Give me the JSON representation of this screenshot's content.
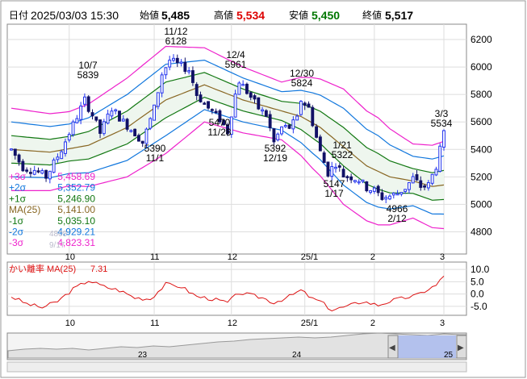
{
  "header": {
    "date_label": "日付",
    "datetime": "2025/03/03 15:30",
    "open_label": "始値",
    "open_value": "5,485",
    "high_label": "高値",
    "high_value": "5,534",
    "low_label": "安値",
    "low_value": "5,450",
    "close_label": "終値",
    "close_value": "5,517"
  },
  "colors": {
    "up_candle": "#2233ee",
    "down_candle": "#111166",
    "band3": "#ee22cc",
    "band2": "#1177dd",
    "band1": "#117711",
    "ma": "#886622",
    "band_fill": "#eef6ee",
    "deviation": "#dd1111",
    "high_value": "#dd0000",
    "low_value": "#007700",
    "navigator_fill": "#aabbee"
  },
  "legend": [
    {
      "label": "+3σ",
      "value": "5,458.69",
      "color": "#ee22cc"
    },
    {
      "label": "+2σ",
      "value": "5,352.79",
      "color": "#1177dd"
    },
    {
      "label": "+1σ",
      "value": "5,246.90",
      "color": "#117711"
    },
    {
      "label": "MA(25)",
      "value": "5,141.00",
      "color": "#886622"
    },
    {
      "label": "-1σ",
      "value": "5,035.10",
      "color": "#117711"
    },
    {
      "label": "-2σ",
      "value": "4,929.21",
      "color": "#1177dd"
    },
    {
      "label": "-3σ",
      "value": "4,823.31",
      "color": "#ee22cc"
    }
  ],
  "ghost_texts": [
    "4808",
    "9/17"
  ],
  "annotations": [
    {
      "line1": "10/7",
      "line2": "5839",
      "anchor": "above"
    },
    {
      "line1": "11/12",
      "line2": "6128",
      "anchor": "above"
    },
    {
      "line1": "12/4",
      "line2": "5961",
      "anchor": "above"
    },
    {
      "line1": "12/30",
      "line2": "5824",
      "anchor": "above"
    },
    {
      "line1": "3/3",
      "line2": "5534",
      "anchor": "above"
    },
    {
      "line1": "5390",
      "line2": "11/1",
      "anchor": "below"
    },
    {
      "line1": "5470",
      "line2": "11/28",
      "anchor": "below"
    },
    {
      "line1": "5392",
      "line2": "12/19",
      "anchor": "below"
    },
    {
      "line1": "1/21",
      "line2": "5322",
      "anchor": "below"
    },
    {
      "line1": "5147",
      "line2": "1/17",
      "anchor": "below"
    },
    {
      "line1": "4966",
      "line2": "2/12",
      "anchor": "below"
    }
  ],
  "deviation_panel": {
    "label": "かい離率 MA(25)",
    "value": "7.31",
    "y_ticks": [
      "10.0",
      "5.0",
      "0.0",
      "-5.0"
    ]
  },
  "navigator": {
    "year_labels": [
      "23",
      "24",
      "25"
    ],
    "left_arrow": "◀",
    "right_arrow": "▶"
  },
  "chart_data": {
    "type": "line",
    "title": "",
    "xlabel": "",
    "ylabel": "",
    "ylim": [
      4650,
      6300
    ],
    "y_ticks": [
      4800,
      5000,
      5200,
      5400,
      5600,
      5800,
      6000,
      6200
    ],
    "x_ticks": [
      {
        "label": "10",
        "index": 15
      },
      {
        "label": "11",
        "index": 37
      },
      {
        "label": "12",
        "index": 57
      },
      {
        "label": "25/1",
        "index": 76
      },
      {
        "label": "2",
        "index": 94
      },
      {
        "label": "3",
        "index": 112
      }
    ],
    "grid": true,
    "candles_count": 113,
    "candle_anchors": [
      [
        0,
        5400
      ],
      [
        3,
        5270
      ],
      [
        6,
        5250
      ],
      [
        9,
        5200
      ],
      [
        13,
        5400
      ],
      [
        16,
        5580
      ],
      [
        19,
        5760
      ],
      [
        21,
        5650
      ],
      [
        23,
        5520
      ],
      [
        26,
        5700
      ],
      [
        29,
        5600
      ],
      [
        32,
        5520
      ],
      [
        34,
        5450
      ],
      [
        37,
        5700
      ],
      [
        39,
        5950
      ],
      [
        41,
        6050
      ],
      [
        43,
        6020
      ],
      [
        46,
        5980
      ],
      [
        48,
        5800
      ],
      [
        51,
        5700
      ],
      [
        54,
        5620
      ],
      [
        56,
        5530
      ],
      [
        58,
        5800
      ],
      [
        59,
        5900
      ],
      [
        62,
        5780
      ],
      [
        64,
        5700
      ],
      [
        66,
        5650
      ],
      [
        68,
        5450
      ],
      [
        70,
        5560
      ],
      [
        72,
        5560
      ],
      [
        74,
        5620
      ],
      [
        75,
        5760
      ],
      [
        77,
        5700
      ],
      [
        80,
        5380
      ],
      [
        82,
        5230
      ],
      [
        84,
        5300
      ],
      [
        86,
        5210
      ],
      [
        88,
        5200
      ],
      [
        90,
        5180
      ],
      [
        92,
        5120
      ],
      [
        94,
        5100
      ],
      [
        96,
        5050
      ],
      [
        98,
        5060
      ],
      [
        100,
        5080
      ],
      [
        102,
        5120
      ],
      [
        104,
        5190
      ],
      [
        106,
        5130
      ],
      [
        108,
        5140
      ],
      [
        110,
        5280
      ],
      [
        112,
        5510
      ]
    ],
    "series": [
      {
        "name": "MA(25)",
        "values": [
          [
            0,
            5400
          ],
          [
            10,
            5380
          ],
          [
            20,
            5430
          ],
          [
            30,
            5560
          ],
          [
            40,
            5760
          ],
          [
            50,
            5870
          ],
          [
            60,
            5760
          ],
          [
            70,
            5680
          ],
          [
            75,
            5640
          ],
          [
            80,
            5560
          ],
          [
            86,
            5420
          ],
          [
            92,
            5280
          ],
          [
            98,
            5200
          ],
          [
            104,
            5170
          ],
          [
            109,
            5130
          ],
          [
            112,
            5141
          ]
        ]
      },
      {
        "name": "+1σ",
        "sd": [
          [
            0,
            100
          ],
          [
            15,
            90
          ],
          [
            30,
            120
          ],
          [
            40,
            130
          ],
          [
            50,
            90
          ],
          [
            60,
            80
          ],
          [
            70,
            70
          ],
          [
            78,
            110
          ],
          [
            86,
            140
          ],
          [
            95,
            130
          ],
          [
            104,
            90
          ],
          [
            112,
            106
          ]
        ]
      }
    ],
    "deviation_values": [
      [
        0,
        -1
      ],
      [
        4,
        -4
      ],
      [
        8,
        -5.5
      ],
      [
        12,
        -3
      ],
      [
        16,
        2
      ],
      [
        20,
        5.5
      ],
      [
        24,
        3
      ],
      [
        28,
        1.5
      ],
      [
        32,
        -1.5
      ],
      [
        36,
        -2
      ],
      [
        40,
        4
      ],
      [
        44,
        3
      ],
      [
        48,
        -1
      ],
      [
        52,
        -2
      ],
      [
        56,
        -3.5
      ],
      [
        59,
        0.5
      ],
      [
        62,
        -0.5
      ],
      [
        65,
        -1.5
      ],
      [
        68,
        -3.5
      ],
      [
        72,
        -1
      ],
      [
        75,
        1.5
      ],
      [
        78,
        -2
      ],
      [
        80,
        -3
      ],
      [
        83,
        -6.5
      ],
      [
        87,
        -5
      ],
      [
        91,
        -3
      ],
      [
        95,
        -4.5
      ],
      [
        99,
        -2.5
      ],
      [
        102,
        -1.5
      ],
      [
        105,
        -0.5
      ],
      [
        108,
        2
      ],
      [
        110,
        3.5
      ],
      [
        112,
        7.3
      ]
    ],
    "deviation_ylim": [
      -8,
      12
    ],
    "navigator_profile": [
      [
        0,
        9
      ],
      [
        20,
        11
      ],
      [
        40,
        12
      ],
      [
        60,
        11
      ],
      [
        80,
        12
      ],
      [
        100,
        10
      ],
      [
        120,
        12
      ],
      [
        140,
        14
      ],
      [
        160,
        13
      ],
      [
        180,
        15
      ],
      [
        200,
        14
      ],
      [
        220,
        16
      ],
      [
        240,
        18
      ],
      [
        260,
        20
      ],
      [
        280,
        21
      ],
      [
        300,
        23
      ],
      [
        320,
        24
      ],
      [
        340,
        25
      ],
      [
        360,
        26
      ],
      [
        380,
        25
      ],
      [
        400,
        26
      ],
      [
        420,
        28
      ],
      [
        440,
        30
      ],
      [
        460,
        31
      ],
      [
        480,
        30
      ],
      [
        500,
        29
      ],
      [
        520,
        28
      ],
      [
        540,
        30
      ],
      [
        560,
        29
      ]
    ]
  }
}
